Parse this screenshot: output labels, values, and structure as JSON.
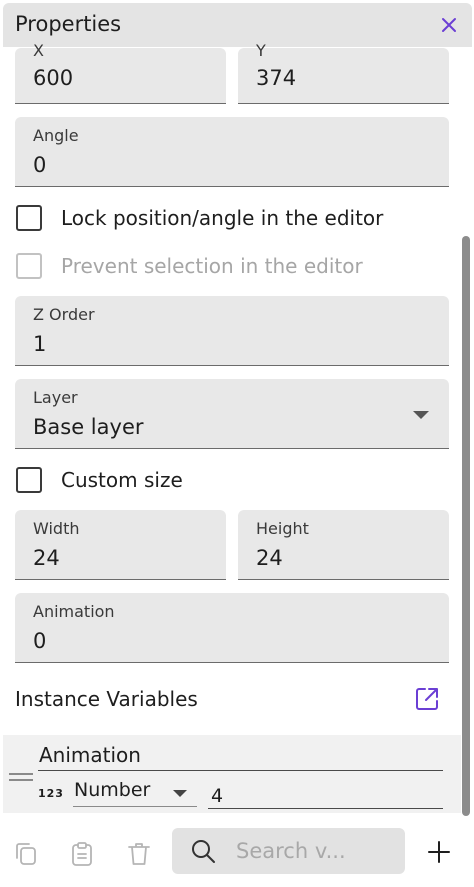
{
  "panel": {
    "title": "Properties"
  },
  "fields": {
    "x": {
      "label": "X",
      "value": "600"
    },
    "y": {
      "label": "Y",
      "value": "374"
    },
    "angle": {
      "label": "Angle",
      "value": "0"
    },
    "z_order": {
      "label": "Z Order",
      "value": "1"
    },
    "layer": {
      "label": "Layer",
      "value": "Base layer"
    },
    "width": {
      "label": "Width",
      "value": "24"
    },
    "height": {
      "label": "Height",
      "value": "24"
    },
    "animation": {
      "label": "Animation",
      "value": "0"
    }
  },
  "checkboxes": {
    "lock": {
      "label": "Lock position/angle in the editor",
      "checked": false
    },
    "prevent": {
      "label": "Prevent selection in the editor",
      "checked": false,
      "disabled": true
    },
    "custom_size": {
      "label": "Custom size",
      "checked": false
    }
  },
  "instance_variables": {
    "title": "Instance Variables",
    "items": [
      {
        "name": "Animation",
        "type_icon": "123",
        "type": "Number",
        "value": "4"
      }
    ]
  },
  "toolbar": {
    "search_placeholder": "Search v...",
    "icons": [
      "copy-icon",
      "paste-icon",
      "trash-icon",
      "search-icon",
      "plus-icon"
    ]
  },
  "colors": {
    "accent": "#6b3fd4",
    "field_bg": "#e8e8e8",
    "titlebar_bg": "#e4e4e4"
  }
}
